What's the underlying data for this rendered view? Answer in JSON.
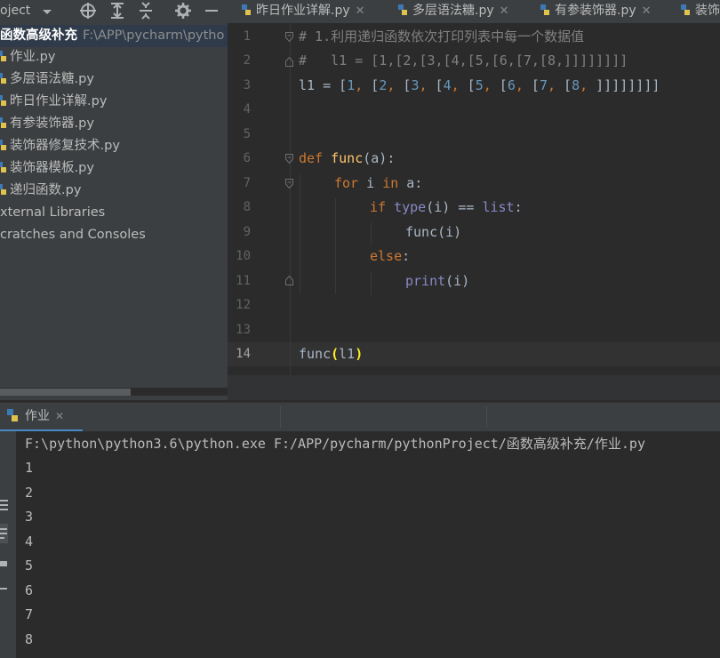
{
  "toolbar": {
    "project_label": "oject",
    "icons": [
      "dropdown-icon",
      "locate-icon",
      "expand-all-icon",
      "collapse-all-icon",
      "gear-icon",
      "minimize-icon"
    ]
  },
  "tabs": [
    {
      "label": "昨日作业详解.py",
      "close": "✕"
    },
    {
      "label": "多层语法糖.py",
      "close": "✕"
    },
    {
      "label": "有参装饰器.py",
      "close": "✕"
    },
    {
      "label": "装饰",
      "close": ""
    }
  ],
  "tree": {
    "root": {
      "name": "函数高级补充",
      "path": "F:\\APP\\pycharm\\pytho"
    },
    "files": [
      "作业.py",
      "多层语法糖.py",
      "昨日作业详解.py",
      "有参装饰器.py",
      "装饰器修复技术.py",
      "装饰器模板.py",
      "递归函数.py"
    ],
    "external": "xternal Libraries",
    "scratches": "cratches and Consoles"
  },
  "editor": {
    "line_numbers": [
      "1",
      "2",
      "3",
      "4",
      "5",
      "6",
      "7",
      "8",
      "9",
      "10",
      "11",
      "12",
      "13",
      "14"
    ],
    "current_line": "14",
    "lines": {
      "l1": "# 1.利用递归函数依次打印列表中每一个数据值",
      "l2": "#   l1 = [1,[2,[3,[4,[5,[6,[7,[8,]]]]]]]]",
      "l3_name": "l1",
      "l3_eq": " = [",
      "n1": "1",
      "n2": "2",
      "n3": "3",
      "n4": "4",
      "n5": "5",
      "n6": "6",
      "n7": "7",
      "n8": "8",
      "l3_tail": "]]]]]]]]",
      "kw_def": "def",
      "fn_func": "func",
      "l6_args": "(a):",
      "kw_for": "for",
      "l7_mid": " i ",
      "kw_in": "in",
      "l7_tail": " a:",
      "kw_if": "if",
      "bi_type": "type",
      "l8_mid": "(i) == ",
      "bi_list": "list",
      "l8_tail": ":",
      "l9": "func(i)",
      "kw_else": "else",
      "l10_tail": ":",
      "bi_print": "print",
      "l11_tail": "(i)",
      "l14_call": "func",
      "l14_open": "(",
      "l14_arg": "l1",
      "l14_close": ")"
    }
  },
  "run": {
    "tab_label": "作业",
    "close": "✕",
    "command": "F:\\python\\python3.6\\python.exe F:/APP/pycharm/pythonProject/函数高级补充/作业.py",
    "output": [
      "1",
      "2",
      "3",
      "4",
      "5",
      "6",
      "7",
      "8"
    ]
  }
}
